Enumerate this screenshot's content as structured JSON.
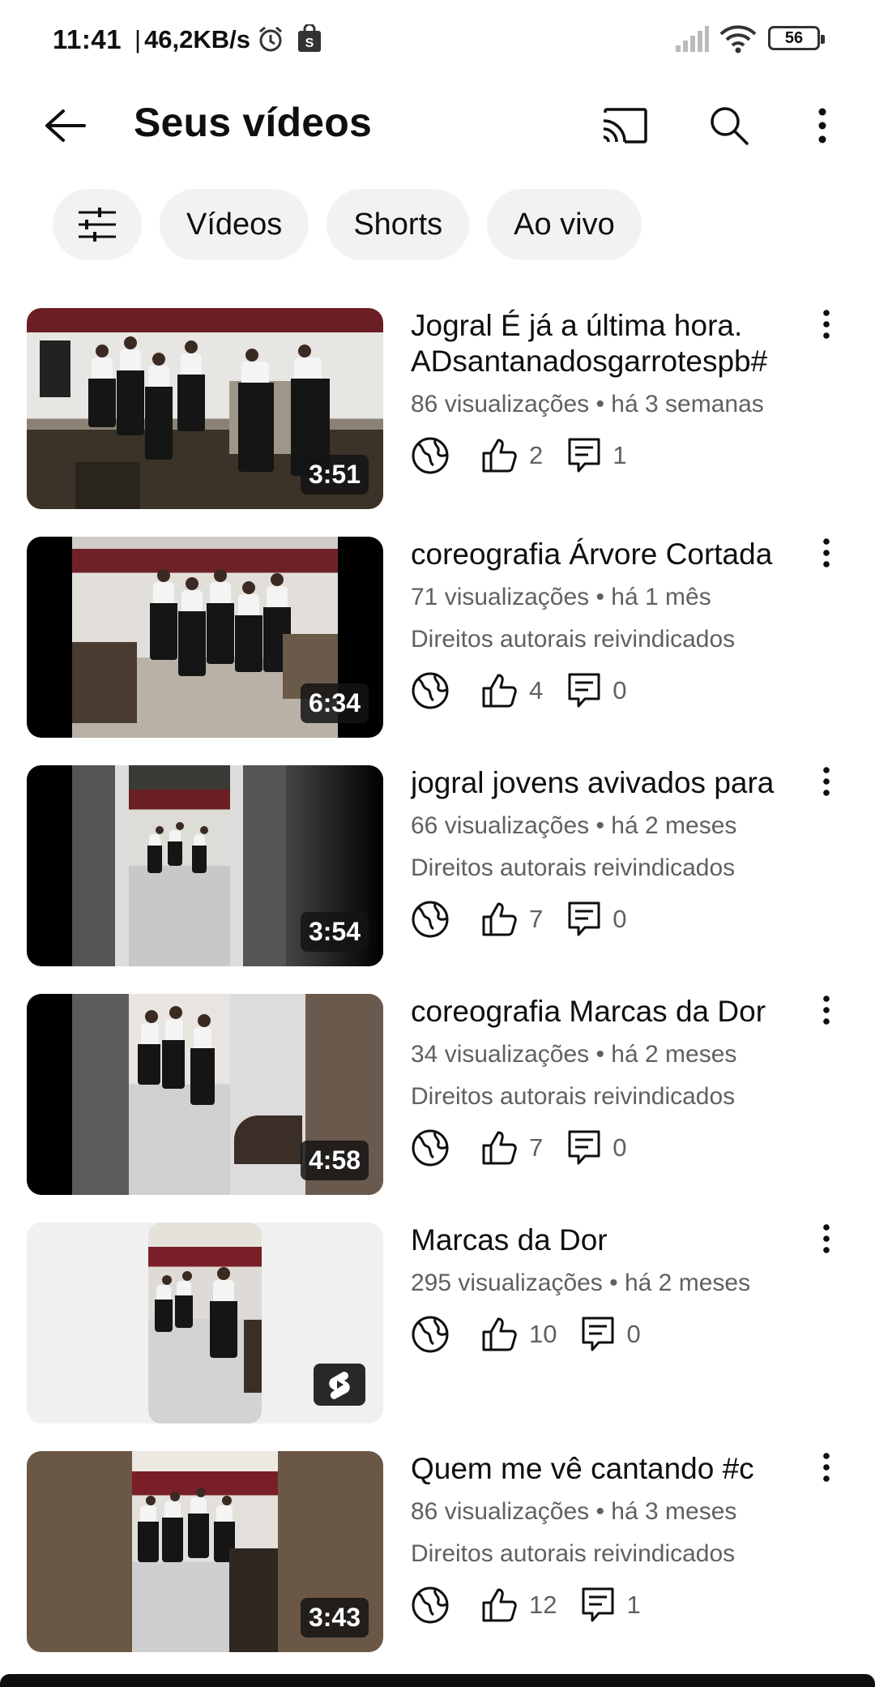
{
  "status_bar": {
    "time": "11:41",
    "separator": "|",
    "speed": "46,2KB/s",
    "battery": "56"
  },
  "header": {
    "title": "Seus vídeos"
  },
  "chips": {
    "videos": "Vídeos",
    "shorts": "Shorts",
    "live": "Ao vivo"
  },
  "videos": [
    {
      "title": "Jogral É já a última hora. ADsantanadosgarrotespb#",
      "meta": "86 visualizações • há 3 semanas",
      "rights": "",
      "duration": "3:51",
      "likes": "2",
      "comments": "1"
    },
    {
      "title": "coreografia Árvore Cortada",
      "meta": "71 visualizações • há 1 mês",
      "rights": "Direitos autorais reivindicados",
      "duration": "6:34",
      "likes": "4",
      "comments": "0"
    },
    {
      "title": "jogral jovens avivados para",
      "meta": "66 visualizações • há 2 meses",
      "rights": "Direitos autorais reivindicados",
      "duration": "3:54",
      "likes": "7",
      "comments": "0"
    },
    {
      "title": "coreografia Marcas da Dor",
      "meta": "34 visualizações • há 2 meses",
      "rights": "Direitos autorais reivindicados",
      "duration": "4:58",
      "likes": "7",
      "comments": "0"
    },
    {
      "title": "Marcas da Dor",
      "meta": "295 visualizações • há 2 meses",
      "rights": "",
      "duration": "",
      "likes": "10",
      "comments": "0"
    },
    {
      "title": "Quem me vê cantando #c",
      "meta": "86 visualizações • há 3 meses",
      "rights": "Direitos autorais reivindicados",
      "duration": "3:43",
      "likes": "12",
      "comments": "1"
    }
  ]
}
